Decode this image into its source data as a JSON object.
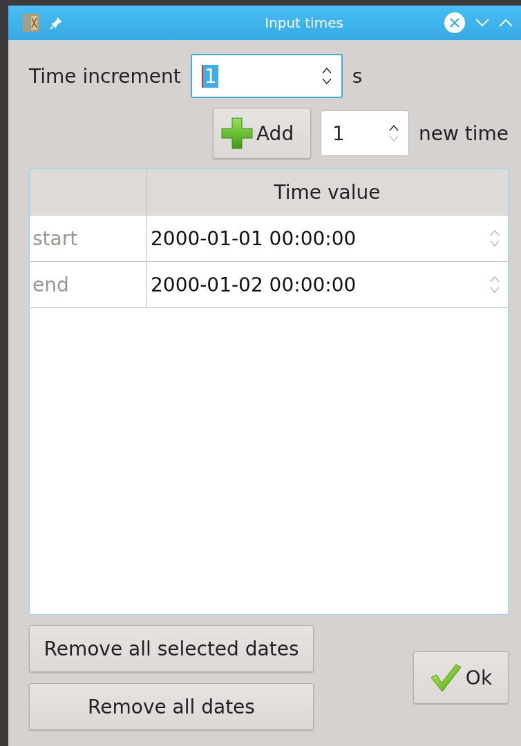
{
  "window": {
    "title": "Input times"
  },
  "time_increment": {
    "label": "Time increment",
    "value": "1",
    "focused": true,
    "unit": "s"
  },
  "add_row": {
    "button": "Add",
    "count": {
      "value": "1",
      "at_minimum": true
    },
    "suffix": "new time"
  },
  "table": {
    "columns": [
      "Time value"
    ],
    "rows": [
      {
        "header": "start",
        "value": "2000-01-01 00:00:00"
      },
      {
        "header": "end",
        "value": "2000-01-02 00:00:00"
      }
    ]
  },
  "buttons": {
    "remove_selected": "Remove all selected dates",
    "remove_all": "Remove all dates",
    "ok": "Ok"
  }
}
